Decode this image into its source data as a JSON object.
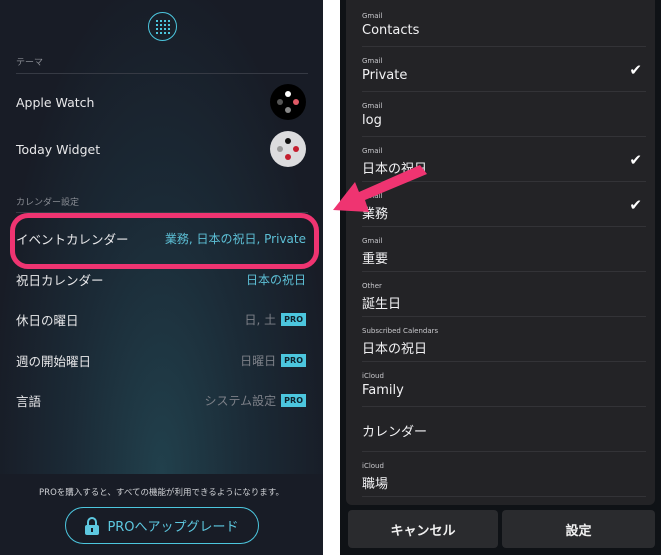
{
  "left": {
    "theme_header": "テーマ",
    "themes": [
      {
        "label": "Apple Watch"
      },
      {
        "label": "Today Widget"
      }
    ],
    "calendar_header": "カレンダー設定",
    "rows": [
      {
        "label": "イベントカレンダー",
        "value": "業務, 日本の祝日, Private",
        "pro": false
      },
      {
        "label": "祝日カレンダー",
        "value": "日本の祝日",
        "pro": false
      },
      {
        "label": "休日の曜日",
        "value": "日, 土",
        "pro": true
      },
      {
        "label": "週の開始曜日",
        "value": "日曜日",
        "pro": true
      },
      {
        "label": "言語",
        "value": "システム設定",
        "pro": true
      }
    ],
    "pro_badge": "PRO",
    "promo_text": "PROを購入すると、すべての機能が利用できるようになります。",
    "upgrade_label": "PROへアップグレード"
  },
  "right": {
    "items": [
      {
        "source": "Gmail",
        "name": "Contacts",
        "checked": false
      },
      {
        "source": "Gmail",
        "name": "Private",
        "checked": true
      },
      {
        "source": "Gmail",
        "name": "log",
        "checked": false
      },
      {
        "source": "Gmail",
        "name": "日本の祝日",
        "checked": true
      },
      {
        "source": "Gmail",
        "name": "業務",
        "checked": true
      },
      {
        "source": "Gmail",
        "name": "重要",
        "checked": false
      },
      {
        "source": "Other",
        "name": "誕生日",
        "checked": false
      },
      {
        "source": "Subscribed Calendars",
        "name": "日本の祝日",
        "checked": false
      },
      {
        "source": "iCloud",
        "name": "Family",
        "checked": false
      },
      {
        "source": "",
        "name": "カレンダー",
        "checked": false
      },
      {
        "source": "iCloud",
        "name": "職場",
        "checked": false
      }
    ],
    "cancel_label": "キャンセル",
    "set_label": "設定"
  },
  "colors": {
    "accent": "#4cc6de",
    "highlight": "#ef3471"
  }
}
